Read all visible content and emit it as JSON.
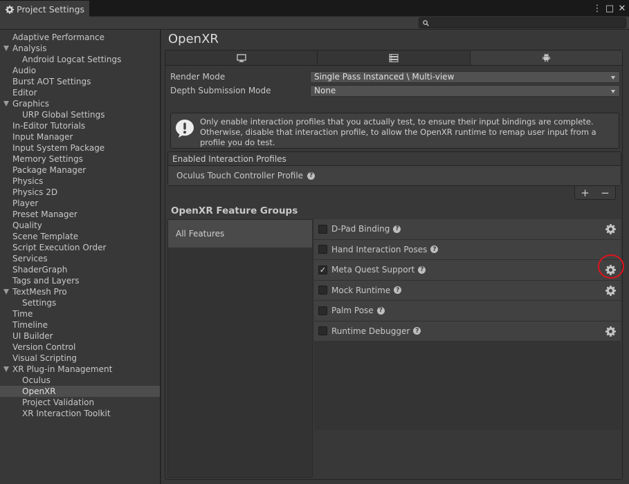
{
  "window": {
    "tab_title": "Project Settings",
    "controls": {
      "more": "⋮",
      "maximize": "□",
      "close": "✕"
    }
  },
  "search": {
    "placeholder": "",
    "value": ""
  },
  "sidebar": {
    "items": [
      {
        "label": "Adaptive Performance",
        "level": 0
      },
      {
        "label": "Analysis",
        "level": 0,
        "expanded": true
      },
      {
        "label": "Android Logcat Settings",
        "level": 1
      },
      {
        "label": "Audio",
        "level": 0
      },
      {
        "label": "Burst AOT Settings",
        "level": 0
      },
      {
        "label": "Editor",
        "level": 0
      },
      {
        "label": "Graphics",
        "level": 0,
        "expanded": true
      },
      {
        "label": "URP Global Settings",
        "level": 1
      },
      {
        "label": "In-Editor Tutorials",
        "level": 0
      },
      {
        "label": "Input Manager",
        "level": 0
      },
      {
        "label": "Input System Package",
        "level": 0
      },
      {
        "label": "Memory Settings",
        "level": 0
      },
      {
        "label": "Package Manager",
        "level": 0
      },
      {
        "label": "Physics",
        "level": 0
      },
      {
        "label": "Physics 2D",
        "level": 0
      },
      {
        "label": "Player",
        "level": 0
      },
      {
        "label": "Preset Manager",
        "level": 0
      },
      {
        "label": "Quality",
        "level": 0
      },
      {
        "label": "Scene Template",
        "level": 0
      },
      {
        "label": "Script Execution Order",
        "level": 0
      },
      {
        "label": "Services",
        "level": 0
      },
      {
        "label": "ShaderGraph",
        "level": 0
      },
      {
        "label": "Tags and Layers",
        "level": 0
      },
      {
        "label": "TextMesh Pro",
        "level": 0,
        "expanded": true
      },
      {
        "label": "Settings",
        "level": 1
      },
      {
        "label": "Time",
        "level": 0
      },
      {
        "label": "Timeline",
        "level": 0
      },
      {
        "label": "UI Builder",
        "level": 0
      },
      {
        "label": "Version Control",
        "level": 0
      },
      {
        "label": "Visual Scripting",
        "level": 0
      },
      {
        "label": "XR Plug-in Management",
        "level": 0,
        "expanded": true
      },
      {
        "label": "Oculus",
        "level": 1
      },
      {
        "label": "OpenXR",
        "level": 1,
        "selected": true
      },
      {
        "label": "Project Validation",
        "level": 1
      },
      {
        "label": "XR Interaction Toolkit",
        "level": 1
      }
    ]
  },
  "main": {
    "title": "OpenXR",
    "platform_tabs": [
      {
        "icon": "monitor-icon",
        "selected": false
      },
      {
        "icon": "server-icon",
        "selected": false
      },
      {
        "icon": "android-icon",
        "selected": true
      }
    ],
    "render_mode": {
      "label": "Render Mode",
      "value": "Single Pass Instanced \\ Multi-view"
    },
    "depth_submission": {
      "label": "Depth Submission Mode",
      "value": "None"
    },
    "help_message": "Only enable interaction profiles that you actually test, to ensure their input bindings are complete. Otherwise, disable that interaction profile, to allow the OpenXR runtime to remap user input from a profile you do test.",
    "profiles": {
      "header": "Enabled Interaction Profiles",
      "items": [
        "Oculus Touch Controller Profile"
      ],
      "add": "+",
      "remove": "−"
    },
    "feature_groups": {
      "title": "OpenXR Feature Groups",
      "groups": [
        "All Features"
      ],
      "features": [
        {
          "label": "D-Pad Binding",
          "checked": false,
          "has_gear": true
        },
        {
          "label": "Hand Interaction Poses",
          "checked": false,
          "has_gear": false
        },
        {
          "label": "Meta Quest Support",
          "checked": true,
          "has_gear": true
        },
        {
          "label": "Mock Runtime",
          "checked": false,
          "has_gear": true
        },
        {
          "label": "Palm Pose",
          "checked": false,
          "has_gear": false
        },
        {
          "label": "Runtime Debugger",
          "checked": false,
          "has_gear": true
        }
      ]
    }
  },
  "colors": {
    "annotation_circle": "#e0141c",
    "panel": "#383838",
    "selected": "#4d4d4d"
  }
}
